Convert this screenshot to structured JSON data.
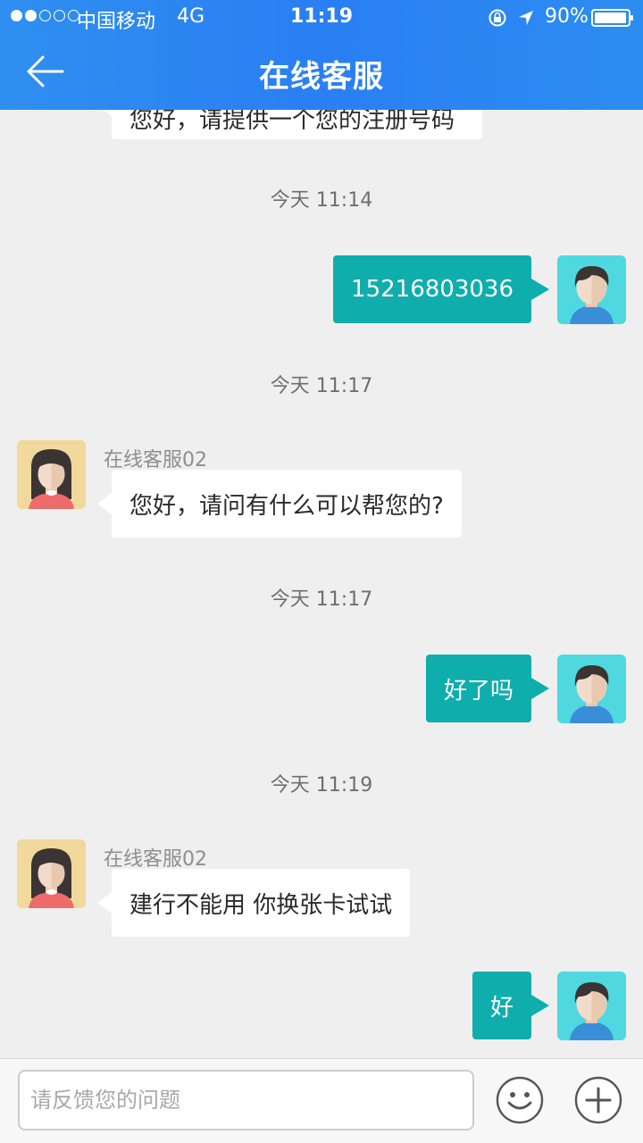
{
  "status_bar": {
    "carrier": "中国移动",
    "network": "4G",
    "time": "11:19",
    "battery": "90%",
    "signal_bars_filled": 2,
    "signal_bars_total": 5
  },
  "header": {
    "title": "在线客服",
    "back_icon": "back-arrow-icon"
  },
  "messages": {
    "partial_top": "您好，请提供一个您的注册号码",
    "t1": "今天 11:14",
    "m1": "15216803036",
    "t2": "今天 11:17",
    "agent1_name": "在线客服02",
    "m2": "您好，请问有什么可以帮您的?",
    "t3": "今天 11:17",
    "m3": "好了吗",
    "t4": "今天 11:19",
    "agent2_name": "在线客服02",
    "m4": "建行不能用 你换张卡试试",
    "m5": "好"
  },
  "input": {
    "placeholder": "请反馈您的问题",
    "emoji_icon": "smiley-icon",
    "add_icon": "plus-icon"
  },
  "colors": {
    "header": "#2a84f2",
    "outgoing_bubble": "#10adad",
    "incoming_bubble": "#ffffff",
    "background": "#efefef"
  }
}
